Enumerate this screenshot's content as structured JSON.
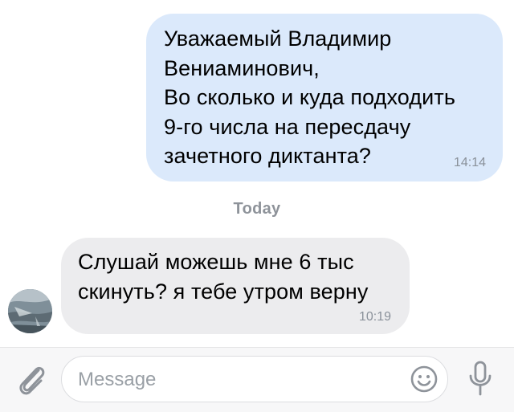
{
  "messages": [
    {
      "direction": "outgoing",
      "text": "Уважаемый Владимир\nВениаминович,\nВо сколько и куда подходить\n9-го числа на пересдачу\nзачетного диктанта?",
      "time": "14:14",
      "bubble_color": "#dbe9fb"
    },
    {
      "direction": "incoming",
      "text": "Слушай можешь мне 6 тыс\nскинуть? я тебе утром верну",
      "time": "10:19",
      "bubble_color": "#ececee"
    }
  ],
  "date_separator": "Today",
  "composer": {
    "placeholder": "Message",
    "attach_icon": "paperclip-icon",
    "emoji_icon": "smiley-icon",
    "mic_icon": "microphone-icon"
  },
  "colors": {
    "icon_gray": "#8e939a",
    "time_gray": "#8a919a"
  }
}
